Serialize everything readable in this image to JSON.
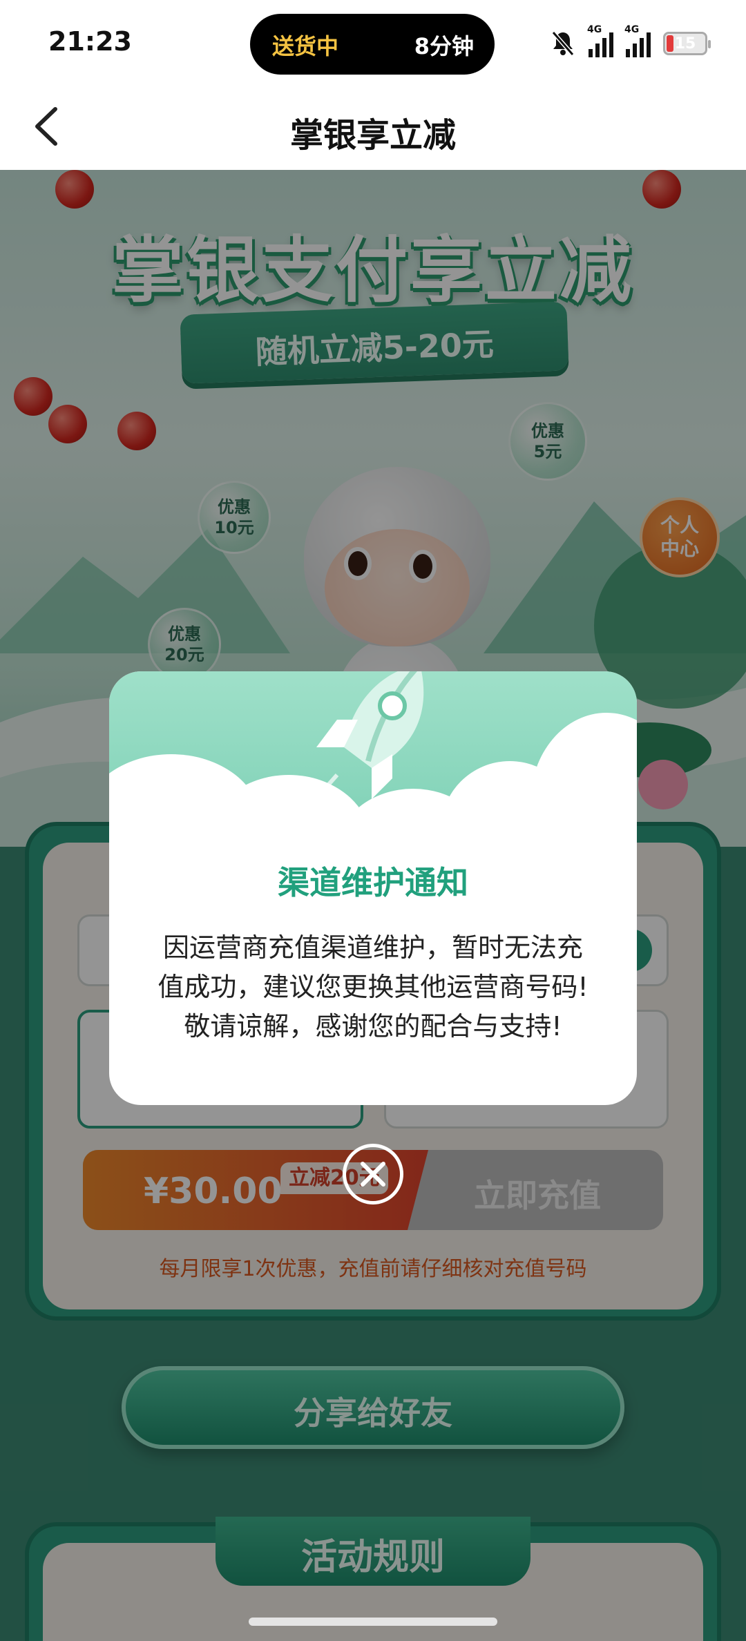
{
  "status_bar": {
    "time": "21:23",
    "delivery_status": "送货中",
    "delivery_eta": "8分钟",
    "signal_label_1": "4G",
    "signal_label_2": "4G",
    "battery": "15"
  },
  "nav": {
    "title": "掌银享立减"
  },
  "hero": {
    "title": "掌银支付享立减",
    "ribbon": "随机立减5-20元",
    "bubbles": [
      {
        "line1": "优惠",
        "line2": "5元"
      },
      {
        "line1": "优惠",
        "line2": "10元"
      },
      {
        "line1": "优惠",
        "line2": "20元"
      }
    ],
    "personal_center": {
      "line1": "个人",
      "line2": "中心"
    }
  },
  "recharge": {
    "price": "¥30.00",
    "discount_tag": "立减20元",
    "pay_now": "立即充值",
    "notice": "每月限享1次优惠，充值前请仔细核对充值号码"
  },
  "share": {
    "label": "分享给好友"
  },
  "rules": {
    "title": "活动规则"
  },
  "modal": {
    "title": "渠道维护通知",
    "body": "因运营商充值渠道维护，暂时无法充值成功，建议您更换其他运营商号码!敬请谅解，感谢您的配合与支持!"
  },
  "colors": {
    "accent": "#21a07d",
    "brand_green": "#2d9e80",
    "warning_orange": "#d9581f",
    "delivery_yellow": "#f5c342"
  },
  "icons": {
    "back": "chevron-left-icon",
    "mute": "bell-off-icon",
    "close": "close-icon",
    "rocket": "rocket-icon"
  }
}
